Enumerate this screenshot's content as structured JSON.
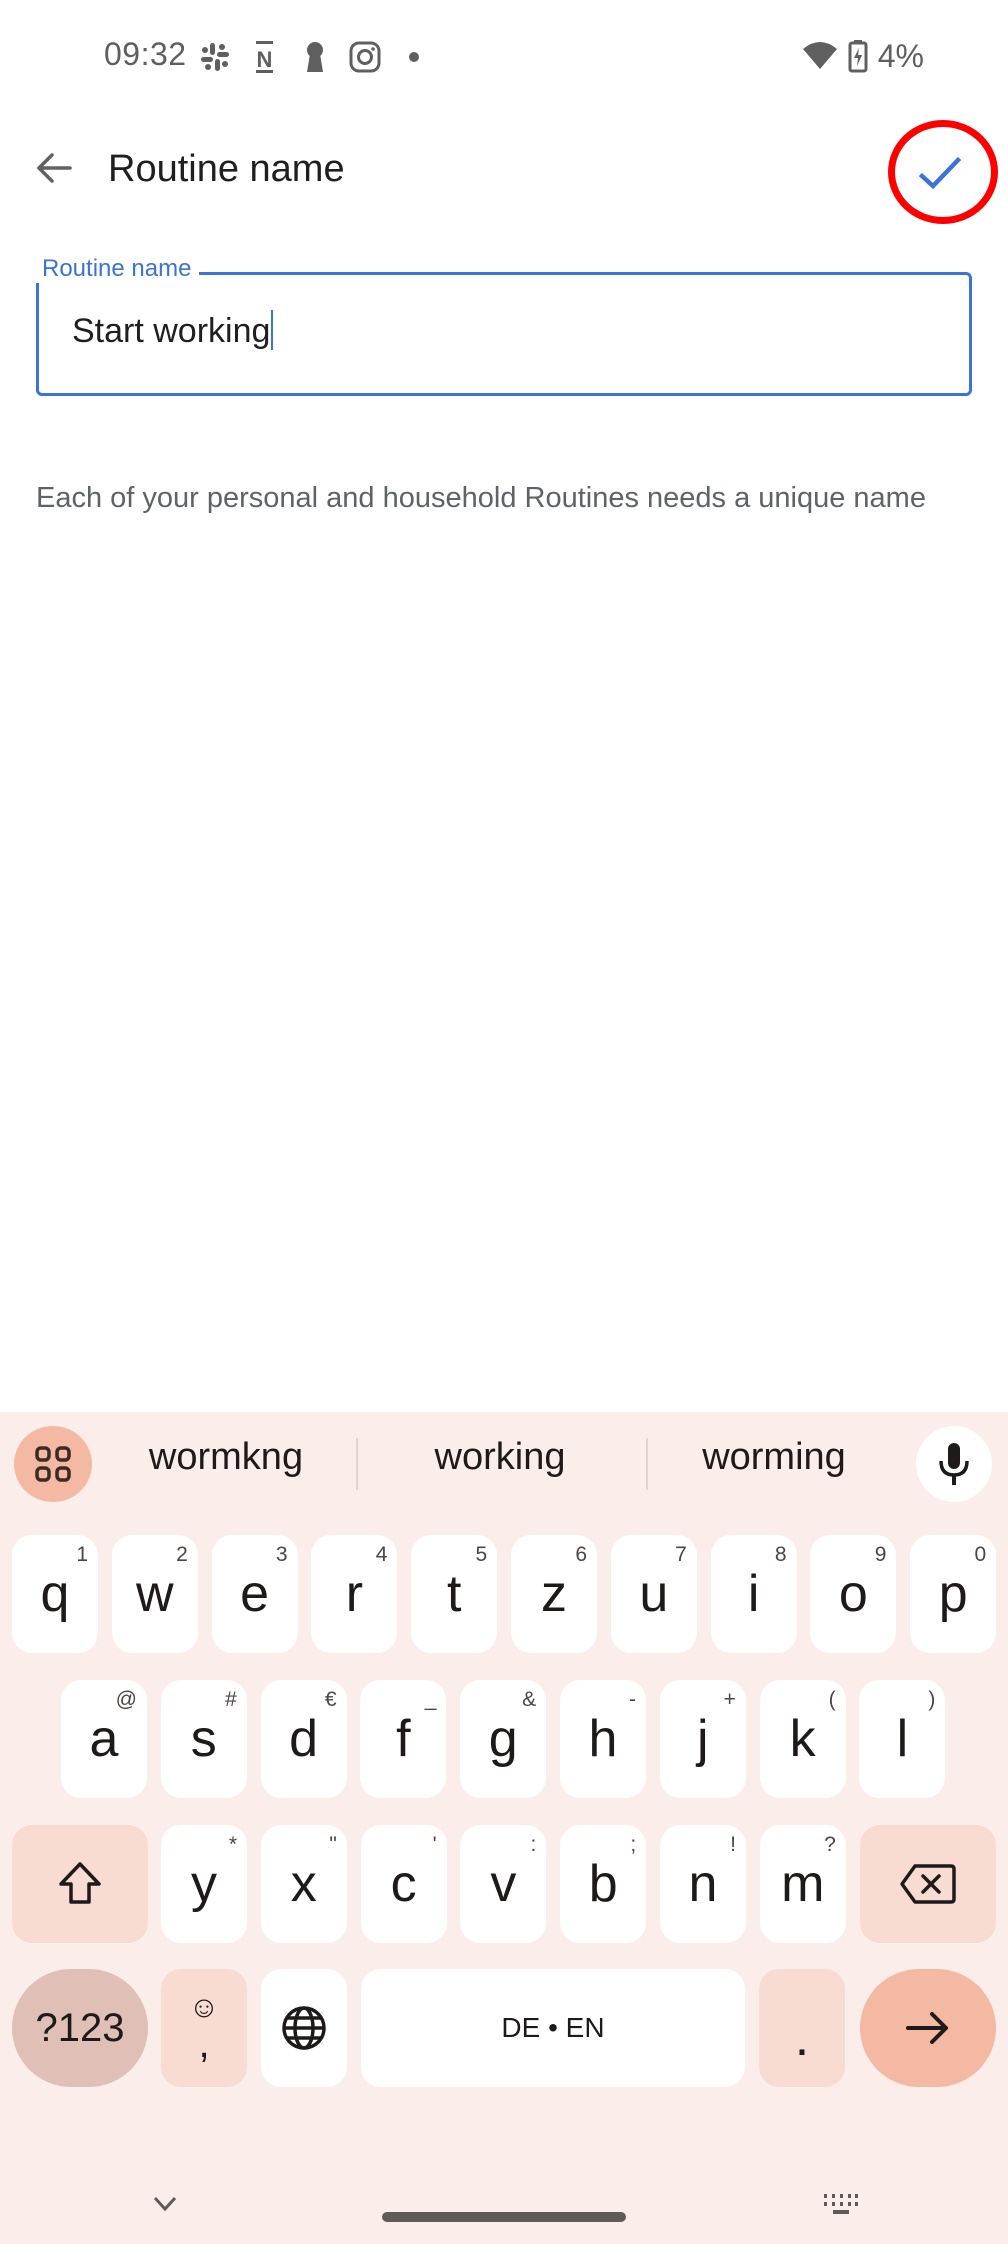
{
  "status_bar": {
    "time": "09:32",
    "notification_icons": [
      "slack-icon",
      "notion-icon",
      "keyhole-icon",
      "instagram-icon",
      "more-dot-icon"
    ],
    "wifi_icon": "wifi-icon",
    "battery_icon": "battery-charging-icon",
    "battery_level": "4%"
  },
  "app_bar": {
    "title": "Routine name",
    "back_icon": "arrow-back-icon",
    "confirm_icon": "check-icon"
  },
  "form": {
    "field_label": "Routine name",
    "field_value": "Start working",
    "helper_text": "Each of your personal and household Routines needs a unique name"
  },
  "keyboard": {
    "suggestions": [
      "wormkng",
      "working",
      "worming"
    ],
    "row1": [
      {
        "key": "q",
        "alt": "1"
      },
      {
        "key": "w",
        "alt": "2"
      },
      {
        "key": "e",
        "alt": "3"
      },
      {
        "key": "r",
        "alt": "4"
      },
      {
        "key": "t",
        "alt": "5"
      },
      {
        "key": "z",
        "alt": "6"
      },
      {
        "key": "u",
        "alt": "7"
      },
      {
        "key": "i",
        "alt": "8"
      },
      {
        "key": "o",
        "alt": "9"
      },
      {
        "key": "p",
        "alt": "0"
      }
    ],
    "row2": [
      {
        "key": "a",
        "alt": "@"
      },
      {
        "key": "s",
        "alt": "#"
      },
      {
        "key": "d",
        "alt": "€"
      },
      {
        "key": "f",
        "alt": "_"
      },
      {
        "key": "g",
        "alt": "&"
      },
      {
        "key": "h",
        "alt": "-"
      },
      {
        "key": "j",
        "alt": "+"
      },
      {
        "key": "k",
        "alt": "("
      },
      {
        "key": "l",
        "alt": ")"
      }
    ],
    "row3": [
      {
        "key": "y",
        "alt": "*"
      },
      {
        "key": "x",
        "alt": "\""
      },
      {
        "key": "c",
        "alt": "'"
      },
      {
        "key": "v",
        "alt": ":"
      },
      {
        "key": "b",
        "alt": ";"
      },
      {
        "key": "n",
        "alt": "!"
      },
      {
        "key": "m",
        "alt": "?"
      }
    ],
    "symbols_label": "?123",
    "comma_label": ",",
    "emoji_icon": "☺",
    "space_label": "DE • EN",
    "period_label": ".",
    "colors": {
      "background": "#fbede9",
      "accent": "#f4b9a3",
      "field_accent": "#3a73d9",
      "highlight": "#ff0000"
    }
  }
}
